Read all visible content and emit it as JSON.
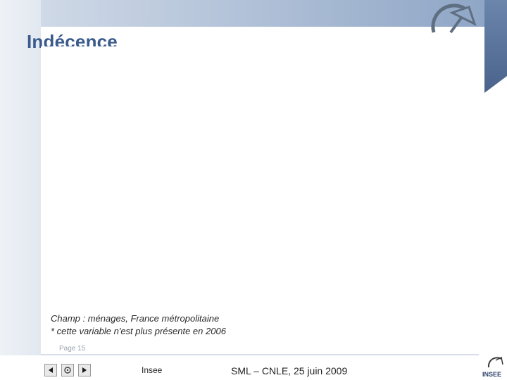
{
  "slide": {
    "title": "Indécence",
    "notes": [
      "Champ : ménages, France métropolitaine",
      "* cette variable n'est plus présente en 2006"
    ],
    "page_label": "Page 15"
  },
  "footer": {
    "left_text": "Insee",
    "center_text": "SML – CNLE, 25 juin 2009",
    "brand_text": "INSEE"
  },
  "nav": {
    "prev_icon": "triangle-left-icon",
    "home_icon": "home-icon",
    "next_icon": "triangle-right-icon"
  },
  "colors": {
    "title": "#3a5a8c",
    "band_dark": "#4a638c",
    "band_light": "#cfd9e7"
  }
}
